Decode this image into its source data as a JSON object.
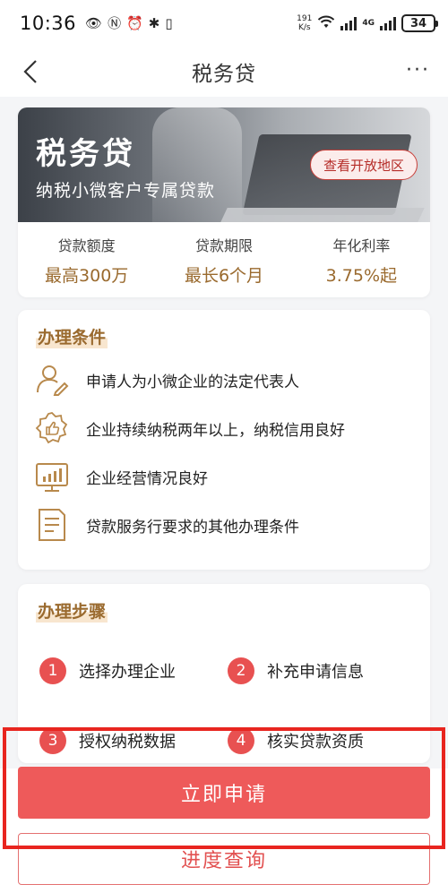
{
  "status_bar": {
    "time": "10:36",
    "net_speed_value": "191",
    "net_speed_unit": "K/s",
    "network_type": "4G",
    "battery": "34"
  },
  "nav": {
    "title": "税务贷",
    "more": "···"
  },
  "hero": {
    "title": "税务贷",
    "subtitle": "纳税小微客户专属贷款",
    "region_button": "查看开放地区",
    "stats": [
      {
        "label": "贷款额度",
        "value": "最高300万"
      },
      {
        "label": "贷款期限",
        "value": "最长6个月"
      },
      {
        "label": "年化利率",
        "value": "3.75%起"
      }
    ]
  },
  "conditions": {
    "title": "办理条件",
    "items": [
      {
        "icon": "user-edit-icon",
        "text": "申请人为小微企业的法定代表人"
      },
      {
        "icon": "thumbs-up-badge-icon",
        "text": "企业持续纳税两年以上，纳税信用良好"
      },
      {
        "icon": "chart-monitor-icon",
        "text": "企业经营情况良好"
      },
      {
        "icon": "document-icon",
        "text": "贷款服务行要求的其他办理条件"
      }
    ]
  },
  "steps": {
    "title": "办理步骤",
    "items": [
      {
        "num": "1",
        "label": "选择办理企业"
      },
      {
        "num": "2",
        "label": "补充申请信息"
      },
      {
        "num": "3",
        "label": "授权纳税数据"
      },
      {
        "num": "4",
        "label": "核实贷款资质"
      }
    ]
  },
  "actions": {
    "apply": "立即申请",
    "query": "进度查询"
  },
  "colors": {
    "accent_red": "#ee5a5a",
    "gold": "#9a6a2e",
    "highlight": "#e8251f"
  }
}
